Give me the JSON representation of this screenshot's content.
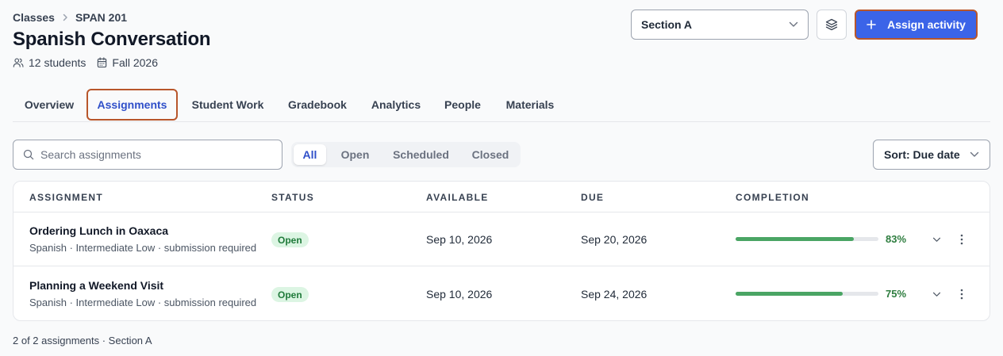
{
  "breadcrumb": {
    "parent": "Classes",
    "current": "SPAN 201"
  },
  "page": {
    "title": "Spanish Conversation",
    "students": "12 students",
    "term": "Fall 2026"
  },
  "header_actions": {
    "section_value": "Section A",
    "assign_label": "Assign activity"
  },
  "tabs": [
    {
      "label": "Overview"
    },
    {
      "label": "Assignments"
    },
    {
      "label": "Student Work"
    },
    {
      "label": "Gradebook"
    },
    {
      "label": "Analytics"
    },
    {
      "label": "People"
    },
    {
      "label": "Materials"
    }
  ],
  "active_tab": "Assignments",
  "search": {
    "placeholder": "Search assignments",
    "value": ""
  },
  "filters": [
    {
      "label": "All"
    },
    {
      "label": "Open"
    },
    {
      "label": "Scheduled"
    },
    {
      "label": "Closed"
    }
  ],
  "active_filter": "All",
  "sort": {
    "label": "Sort: Due date"
  },
  "table": {
    "headers": {
      "assignment": "ASSIGNMENT",
      "status": "STATUS",
      "available": "AVAILABLE",
      "due": "DUE",
      "completion": "COMPLETION"
    },
    "rows": [
      {
        "title": "Ordering Lunch in Oaxaca",
        "subtitle": "Spanish · Intermediate Low · submission required",
        "status": "Open",
        "available": "Sep 10, 2026",
        "due": "Sep 20, 2026",
        "completion": 83,
        "completion_label": "83%"
      },
      {
        "title": "Planning a Weekend Visit",
        "subtitle": "Spanish · Intermediate Low · submission required",
        "status": "Open",
        "available": "Sep 10, 2026",
        "due": "Sep 24, 2026",
        "completion": 75,
        "completion_label": "75%"
      }
    ]
  },
  "footer": {
    "summary": "2 of 2 assignments · Section A"
  },
  "colors": {
    "accent": "#3b64e8",
    "active_text": "#2f4fc9",
    "focus_outline": "#b8562b",
    "progress": "#4aa564",
    "open_badge_bg": "#dcf5e3",
    "open_badge_text": "#1f7a3a"
  },
  "icons": {
    "breadcrumb_separator": "chevron-right-icon",
    "students": "users-icon",
    "term": "calendar-icon",
    "section_dropdown": "chevron-down-icon",
    "layers": "layers-icon",
    "assign": "plus-icon",
    "search": "search-icon",
    "sort_dropdown": "chevron-down-icon",
    "row_expand": "chevron-down-icon",
    "row_menu": "more-vertical-icon"
  }
}
